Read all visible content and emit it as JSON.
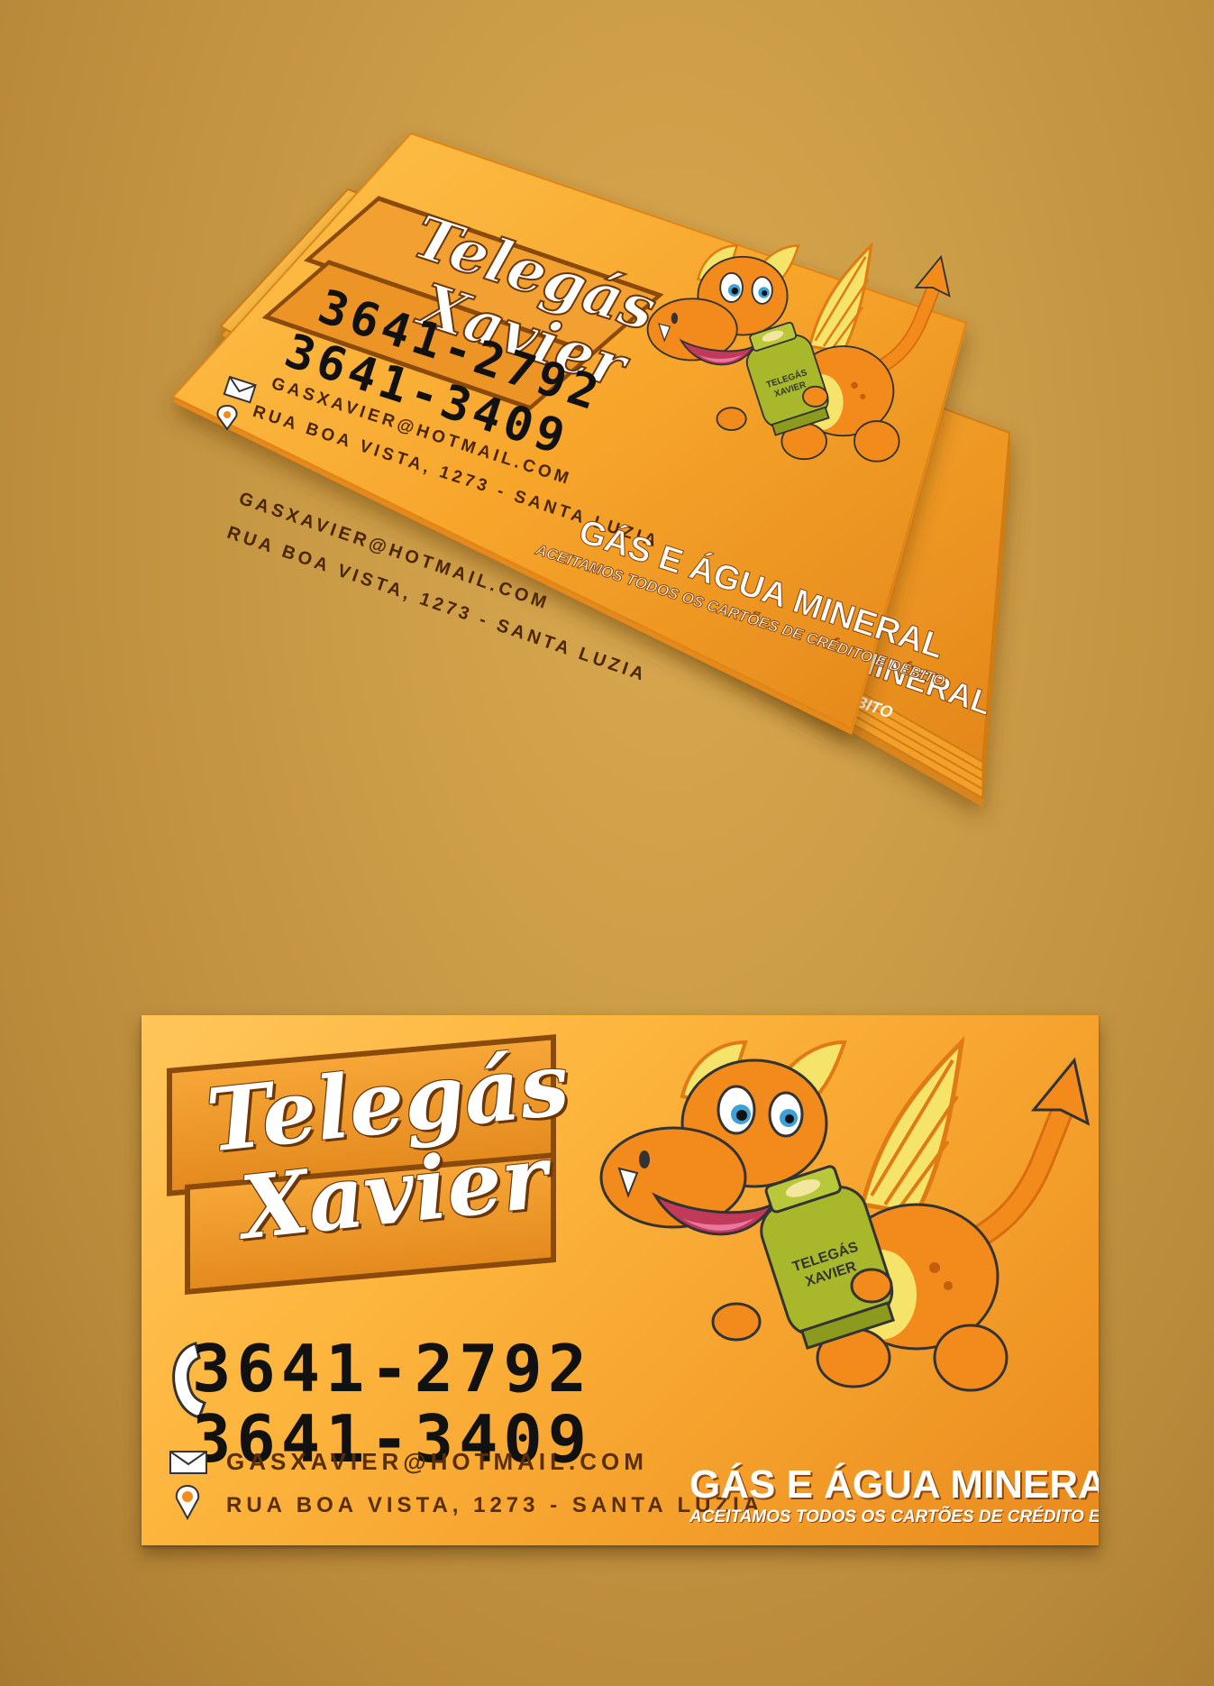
{
  "brand": {
    "line1": "Telegás",
    "line2": "Xavier"
  },
  "phones": [
    "3641-2792",
    "3641-3409"
  ],
  "email": "GASXAVIER@HOTMAIL.COM",
  "address": "RUA BOA VISTA, 1273 - SANTA LUZIA",
  "headline": "GÁS E ÁGUA MINERAL",
  "subline": "ACEITAMOS TODOS OS CARTÕES DE CRÉDITO E DÉBITO",
  "cylinder_label": {
    "line1": "TELEGÁS",
    "line2": "XAVIER"
  },
  "colors": {
    "card": "#fdb53d",
    "card_dark": "#e88a1e",
    "outline": "#8a4a0c",
    "dragon": "#f28a1c",
    "wing": "#f5e36a",
    "cylinder": "#a8b82a"
  },
  "icons": [
    "phone-icon",
    "mail-icon",
    "location-pin-icon"
  ]
}
